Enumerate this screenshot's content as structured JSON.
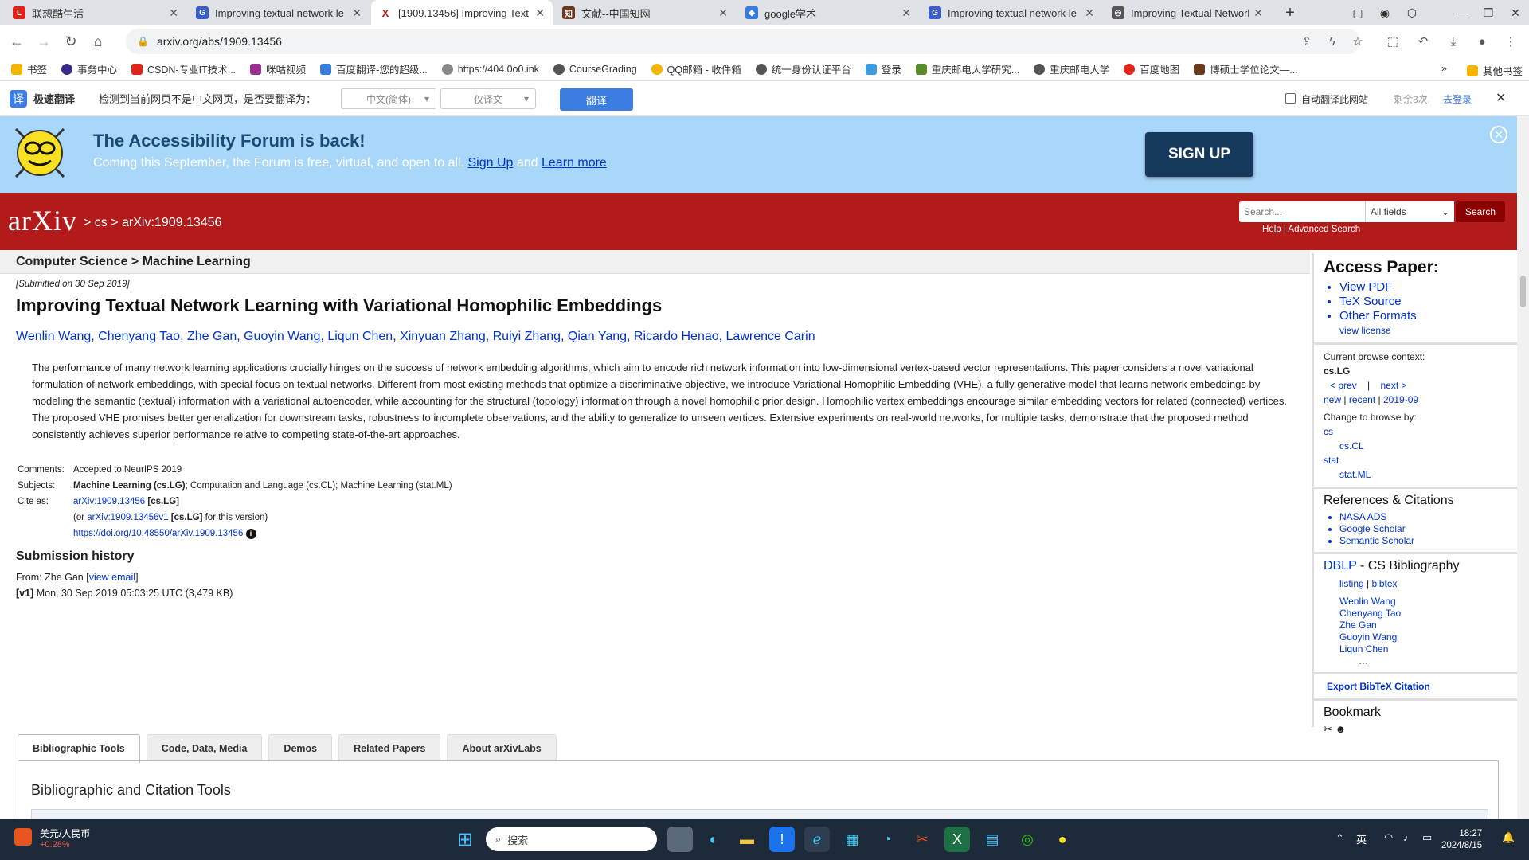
{
  "browser": {
    "tabs": [
      {
        "label": "联想酷生活",
        "icon_color": "#e2231a",
        "icon_text": "L"
      },
      {
        "label": "Improving textual network le",
        "icon_color": "#3a5fcd",
        "icon_text": "G"
      },
      {
        "label": "[1909.13456] Improving Text",
        "icon_color": "#b31b1b",
        "icon_text": "X",
        "active": true
      },
      {
        "label": "文献--中国知网",
        "icon_color": "#6b3a1e",
        "icon_text": "知"
      },
      {
        "label": "google学术",
        "icon_color": "#3a7be0",
        "icon_text": "◆"
      },
      {
        "label": "Improving textual network le",
        "icon_color": "#3a5fcd",
        "icon_text": "G"
      },
      {
        "label": "Improving Textual Network L",
        "icon_color": "#555555",
        "icon_text": "◎"
      }
    ],
    "url": "arxiv.org/abs/1909.13456",
    "bookmarks": [
      "书签",
      "事务中心",
      "CSDN-专业IT技术...",
      "咪咕视频",
      "百度翻译-您的超级...",
      "https://404.0o0.ink",
      "CourseGrading",
      "QQ邮箱 - 收件箱",
      "统一身份认证平台",
      "登录",
      "重庆邮电大学研究...",
      "重庆邮电大学",
      "百度地图",
      "博硕士学位论文—..."
    ],
    "other_bookmarks": "其他书签"
  },
  "translate_bar": {
    "logo": "译",
    "name": "极速翻译",
    "prompt": "检测到当前网页不是中文网页，是否要翻译为：",
    "lang": "中文(简体)",
    "mode": "仅译文",
    "button": "翻译",
    "auto_label": "自动翻译此网站",
    "remaining": "剩余3次,",
    "login": "去登录"
  },
  "banner": {
    "title": "The Accessibility Forum is back!",
    "sub_text": "Coming this September, the Forum is free, virtual, and open to all.",
    "sign_up_link": "Sign Up",
    "and": "and",
    "learn_more": "Learn more",
    "signup_button": "SIGN UP"
  },
  "header": {
    "logo": "arXiv",
    "breadcrumb": "> cs > arXiv:1909.13456",
    "search_placeholder": "Search...",
    "search_field": "All fields",
    "search_button": "Search",
    "help": "Help | Advanced Search"
  },
  "paper": {
    "subject_bar": "Computer Science > Machine Learning",
    "submitted": "[Submitted on 30 Sep 2019]",
    "title": "Improving Textual Network Learning with Variational Homophilic Embeddings",
    "authors": [
      "Wenlin Wang",
      "Chenyang Tao",
      "Zhe Gan",
      "Guoyin Wang",
      "Liqun Chen",
      "Xinyuan Zhang",
      "Ruiyi Zhang",
      "Qian Yang",
      "Ricardo Henao",
      "Lawrence Carin"
    ],
    "abstract": "The performance of many network learning applications crucially hinges on the success of network embedding algorithms, which aim to encode rich network information into low-dimensional vertex-based vector representations. This paper considers a novel variational formulation of network embeddings, with special focus on textual networks. Different from most existing methods that optimize a discriminative objective, we introduce Variational Homophilic Embedding (VHE), a fully generative model that learns network embeddings by modeling the semantic (textual) information with a variational autoencoder, while accounting for the structural (topology) information through a novel homophilic prior design. Homophilic vertex embeddings encourage similar embedding vectors for related (connected) vertices. The proposed VHE promises better generalization for downstream tasks, robustness to incomplete observations, and the ability to generalize to unseen vertices. Extensive experiments on real-world networks, for multiple tasks, demonstrate that the proposed method consistently achieves superior performance relative to competing state-of-the-art approaches.",
    "comments_label": "Comments:",
    "comments": "Accepted to NeurIPS 2019",
    "subjects_label": "Subjects:",
    "subjects_primary": "Machine Learning (cs.LG)",
    "subjects_rest": "; Computation and Language (cs.CL); Machine Learning (stat.ML)",
    "cite_label": "Cite as:",
    "cite_id": "arXiv:1909.13456",
    "cite_cat": "[cs.LG]",
    "cite_or": "(or",
    "cite_v1": "arXiv:1909.13456v1",
    "cite_v1_tail": "for this version)",
    "doi": "https://doi.org/10.48550/arXiv.1909.13456",
    "history_title": "Submission history",
    "from_label": "From: Zhe Gan [",
    "view_email": "view email",
    "from_end": "]",
    "v1_label": "[v1]",
    "v1_date": "Mon, 30 Sep 2019 05:03:25 UTC (3,479 KB)"
  },
  "lab_tabs": [
    "Bibliographic Tools",
    "Code, Data, Media",
    "Demos",
    "Related Papers",
    "About arXivLabs"
  ],
  "tab_panel_title": "Bibliographic and Citation Tools",
  "sidebar": {
    "access_title": "Access Paper:",
    "access_links": [
      "View PDF",
      "TeX Source",
      "Other Formats"
    ],
    "view_license": "view license",
    "browse_context_label": "Current browse context:",
    "browse_context": "cs.LG",
    "prev": "< prev",
    "sep": "|",
    "next": "next >",
    "new": "new",
    "recent": "recent",
    "month": "2019-09",
    "change_label": "Change to browse by:",
    "browse_cs": "cs",
    "browse_cs_cl": "cs.CL",
    "browse_stat": "stat",
    "browse_stat_ml": "stat.ML",
    "refs_title": "References & Citations",
    "refs": [
      "NASA ADS",
      "Google Scholar",
      "Semantic Scholar"
    ],
    "dblp_link": "DBLP",
    "dblp_title": " - CS Bibliography",
    "listing": "listing",
    "bibtex": "bibtex",
    "dblp_authors": [
      "Wenlin Wang",
      "Chenyang Tao",
      "Zhe Gan",
      "Guoyin Wang",
      "Liqun Chen"
    ],
    "ellipsis": "…",
    "export": "Export BibTeX Citation",
    "bookmark_title": "Bookmark"
  },
  "taskbar": {
    "stock_label": "美元/人民币",
    "stock_change": "+0.28%",
    "search": "搜索",
    "ime": "英",
    "time": "18:27",
    "date": "2024/8/15"
  }
}
